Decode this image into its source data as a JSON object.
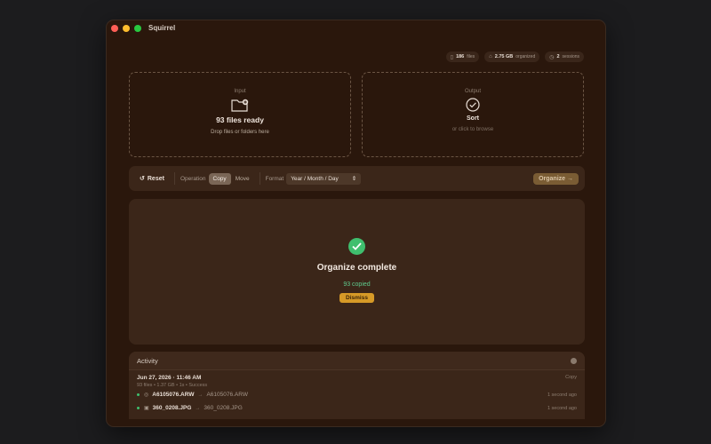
{
  "app": {
    "title": "Squirrel"
  },
  "stats": [
    {
      "icon": "file-icon",
      "value": "186",
      "label": "files"
    },
    {
      "icon": "disk-icon",
      "value": "2.75 GB",
      "label": "organized"
    },
    {
      "icon": "clock-icon",
      "value": "2",
      "label": "sessions"
    }
  ],
  "input": {
    "label": "Input",
    "title": "93 files ready",
    "hint": "Drop files or folders here"
  },
  "output": {
    "label": "Output",
    "title": "Sort",
    "hint": "or click to browse"
  },
  "toolbar": {
    "reset_label": "Reset",
    "operation_label": "Operation",
    "operations": [
      "Copy",
      "Move"
    ],
    "operation_selected": "Copy",
    "format_label": "Format",
    "format_value": "Year / Month / Day",
    "organize_label": "Organize →"
  },
  "result": {
    "title": "Organize complete",
    "summary": "93 copied",
    "dismiss_label": "Dismiss"
  },
  "activity": {
    "title": "Activity",
    "session": {
      "date": "Jun 27, 2026 · 11:46 AM",
      "operation": "Copy",
      "meta": "93 files • 1.37 GB • 1s • Success"
    },
    "files": [
      {
        "icon": "raw-file-icon",
        "name": "A6105076.ARW",
        "dest": "A6105076.ARW",
        "time": "1 second ago"
      },
      {
        "icon": "image-file-icon",
        "name": "360_0208.JPG",
        "dest": "360_0208.JPG",
        "time": "1 second ago"
      }
    ]
  },
  "colors": {
    "window_bg": "#2a170c",
    "panel_bg": "#3b2619",
    "success": "#3fbf6e",
    "accent": "#d69a27"
  }
}
